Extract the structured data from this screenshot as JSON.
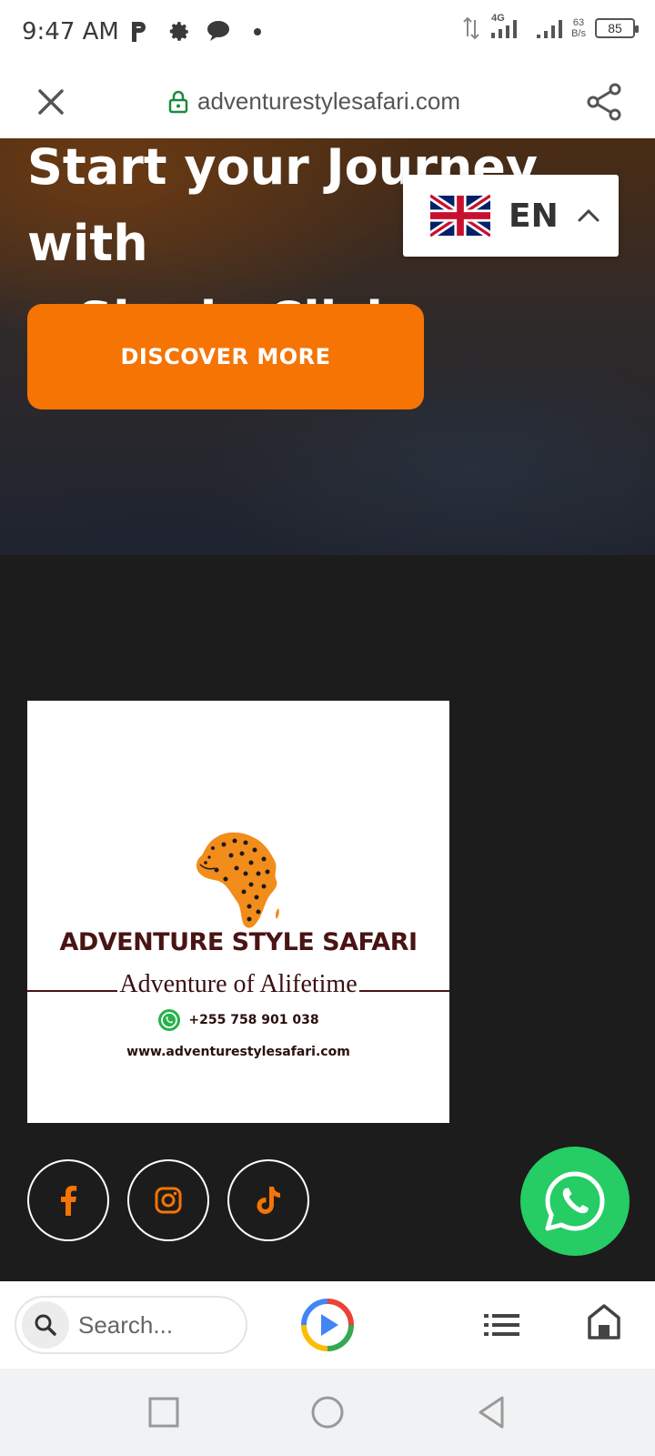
{
  "status": {
    "time": "9:47 AM",
    "network": "4G",
    "speed_value": "63",
    "speed_unit": "B/s",
    "battery": "85"
  },
  "browser": {
    "url": "adventurestylesafari.com",
    "search_placeholder": "Search..."
  },
  "hero": {
    "title_line1": "Start your Journey with",
    "title_line2": "a Single Click",
    "cta_label": "DISCOVER MORE"
  },
  "language": {
    "code": "EN",
    "flag": "uk-flag-icon"
  },
  "logo": {
    "brand": "ADVENTURE STYLE SAFARI",
    "tagline": "Adventure of Alifetime",
    "phone": "+255 758 901 038",
    "website": "www.adventurestylesafari.com"
  },
  "social": [
    {
      "name": "facebook-icon"
    },
    {
      "name": "instagram-icon"
    },
    {
      "name": "tiktok-icon"
    }
  ],
  "colors": {
    "accent": "#f57404",
    "whatsapp": "#26cc64",
    "footer_bg": "#1c1c1c",
    "brand_text": "#4a1414"
  }
}
